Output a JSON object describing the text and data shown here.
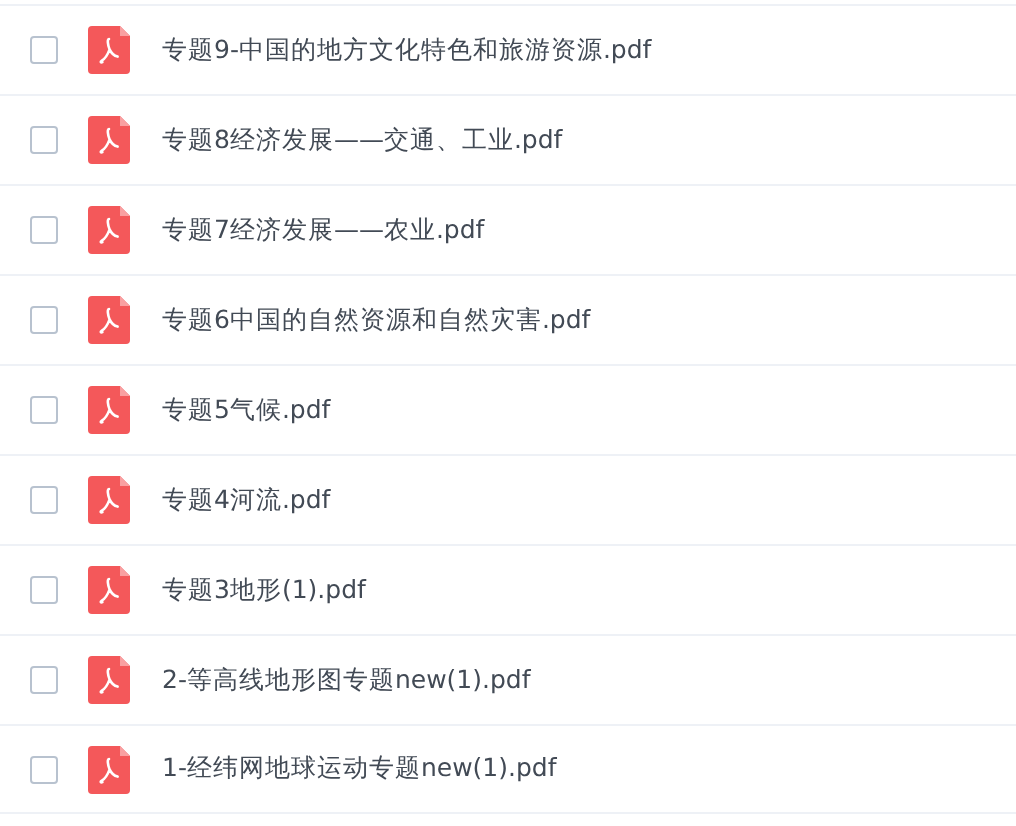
{
  "files": [
    {
      "name": "专题9-中国的地方文化特色和旅游资源.pdf",
      "checked": false
    },
    {
      "name": "专题8经济发展——交通、工业.pdf",
      "checked": false
    },
    {
      "name": "专题7经济发展——农业.pdf",
      "checked": false
    },
    {
      "name": "专题6中国的自然资源和自然灾害.pdf",
      "checked": false
    },
    {
      "name": "专题5气候.pdf",
      "checked": false
    },
    {
      "name": "专题4河流.pdf",
      "checked": false
    },
    {
      "name": "专题3地形(1).pdf",
      "checked": false
    },
    {
      "name": "2-等高线地形图专题new(1).pdf",
      "checked": false
    },
    {
      "name": "1-经纬网地球运动专题new(1).pdf",
      "checked": false
    }
  ]
}
